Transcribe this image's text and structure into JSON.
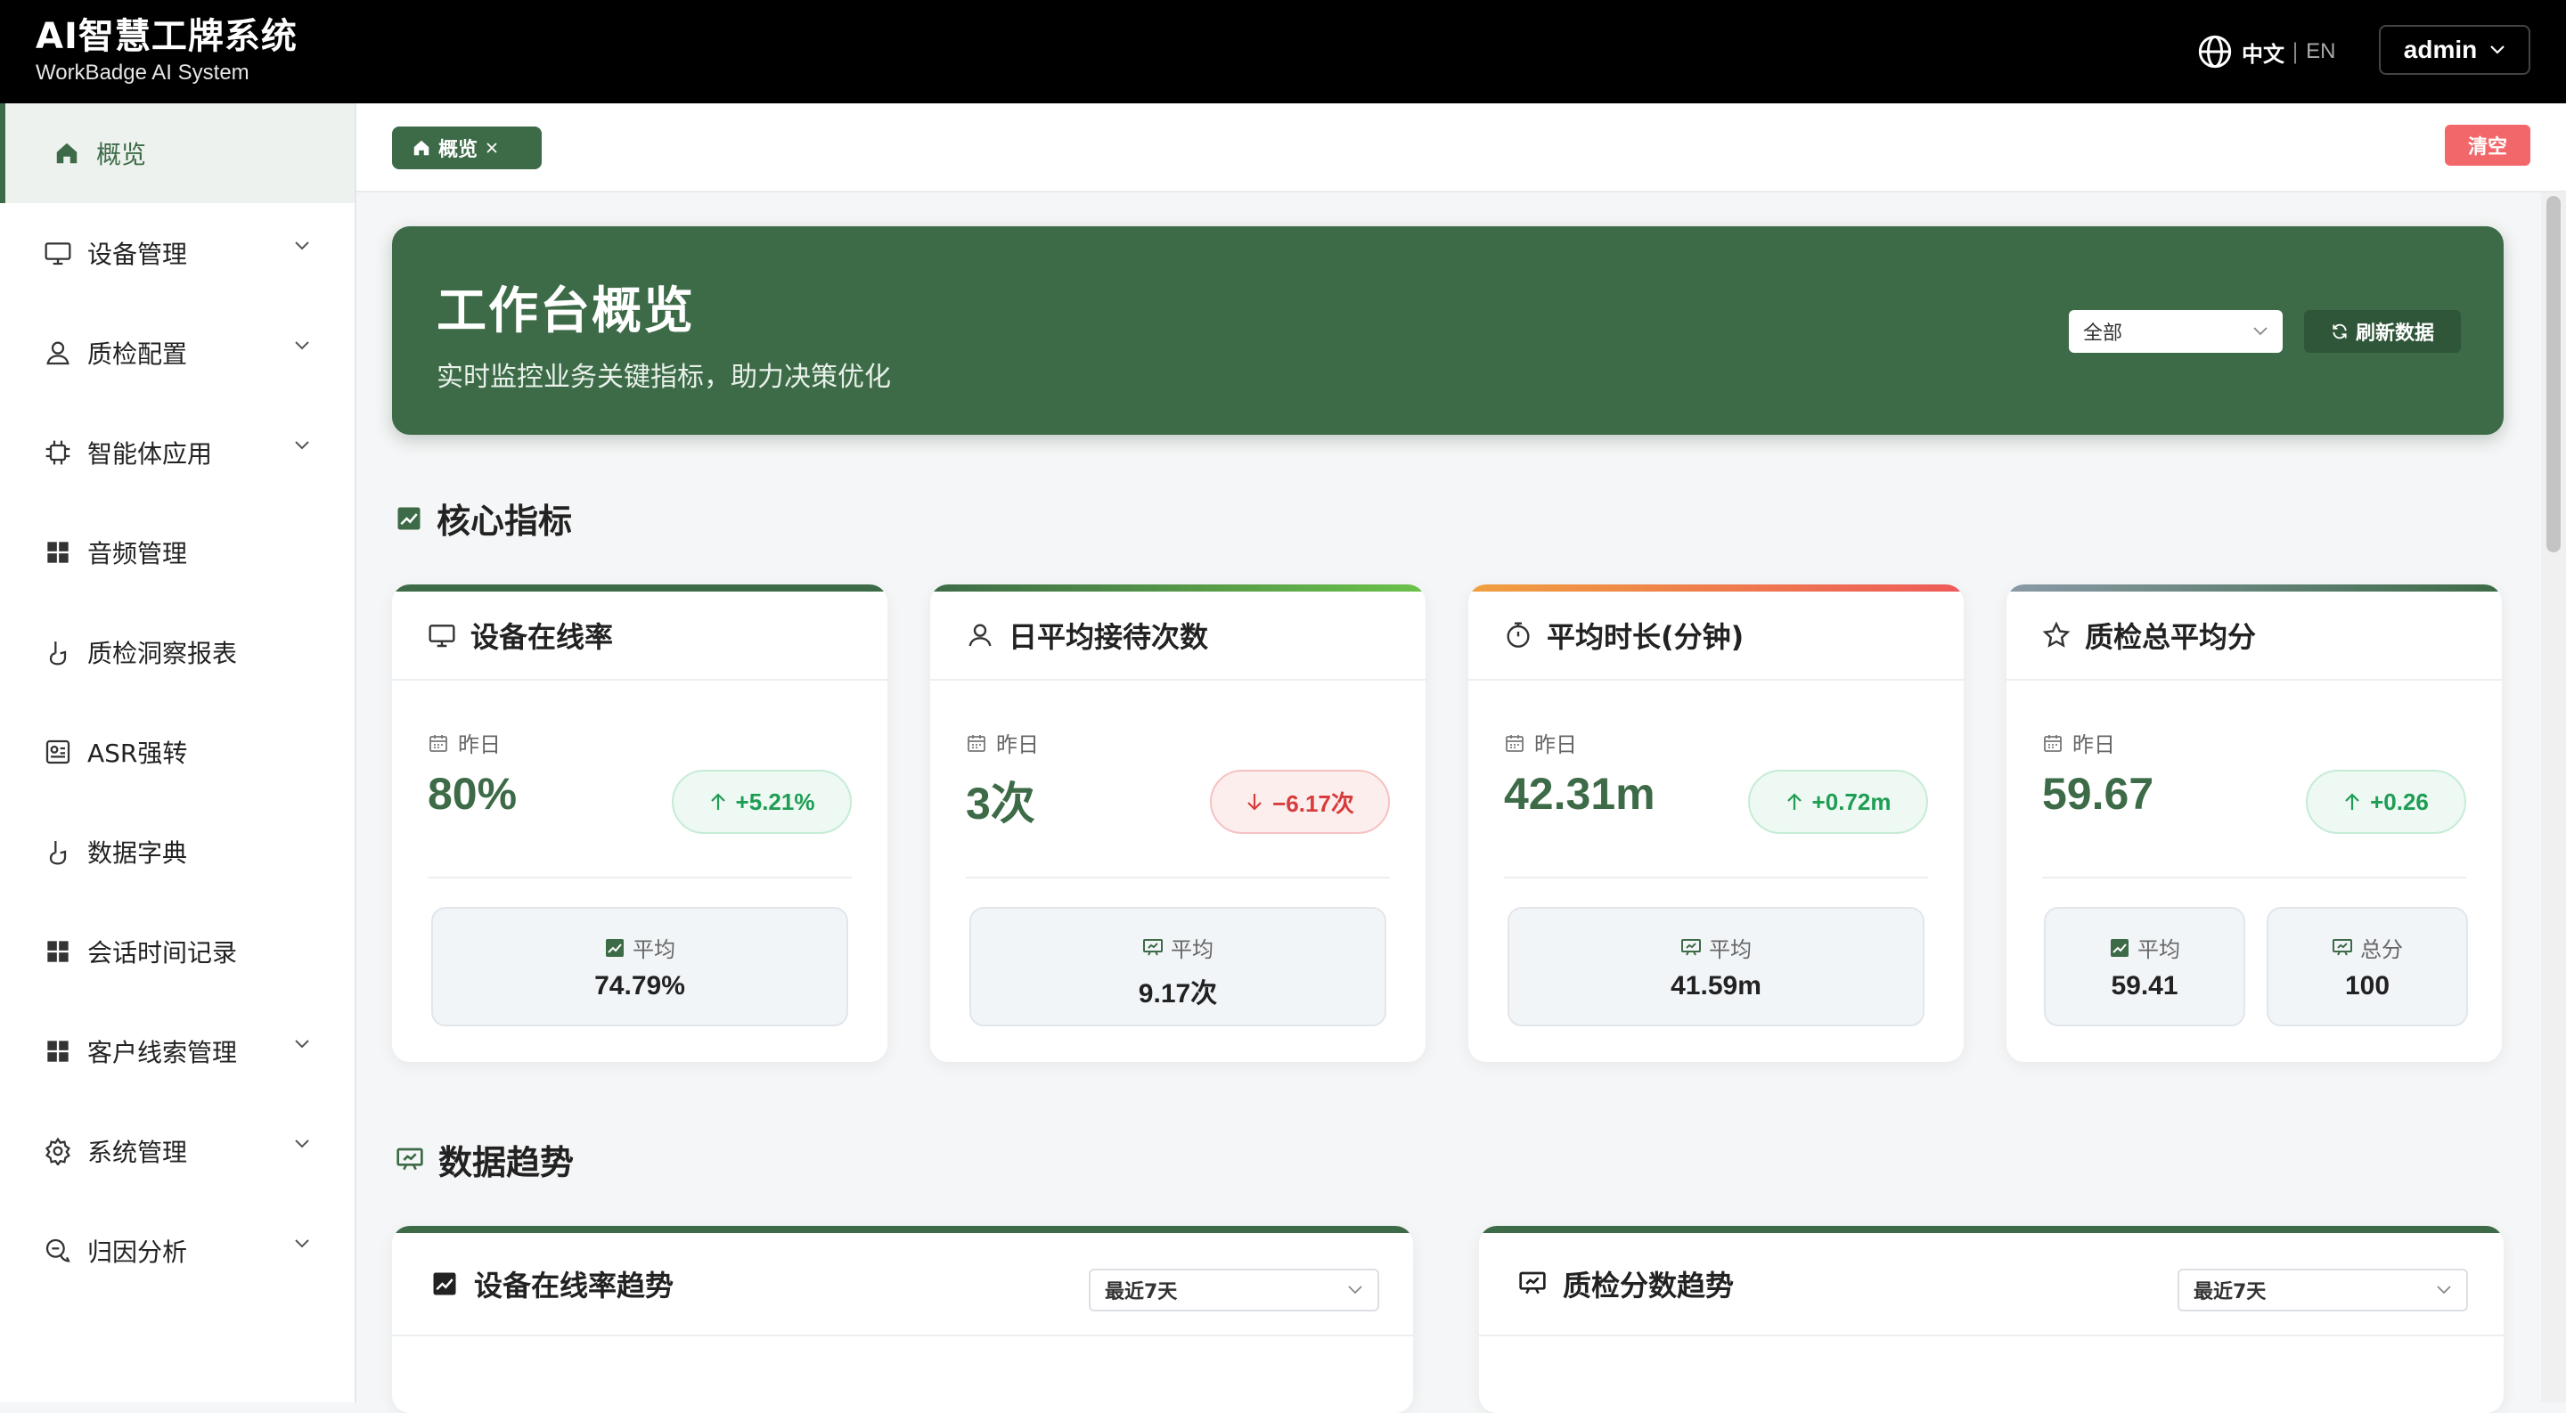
{
  "brand": {
    "title": "AI智慧工牌系统",
    "subtitle": "WorkBadge AI System"
  },
  "header": {
    "lang_active": "中文",
    "lang_sep": "|",
    "lang_other": "EN",
    "user": "admin"
  },
  "sidebar": {
    "items": [
      {
        "label": "概览",
        "icon": "home-icon",
        "active": true,
        "expandable": false
      },
      {
        "label": "设备管理",
        "icon": "monitor-icon",
        "expandable": true
      },
      {
        "label": "质检配置",
        "icon": "user-icon",
        "expandable": true
      },
      {
        "label": "智能体应用",
        "icon": "chip-icon",
        "expandable": true
      },
      {
        "label": "音频管理",
        "icon": "grid-icon",
        "expandable": false
      },
      {
        "label": "质检洞察报表",
        "icon": "hand-icon",
        "expandable": false
      },
      {
        "label": "ASR强转",
        "icon": "asr-icon",
        "expandable": false
      },
      {
        "label": "数据字典",
        "icon": "hand-icon",
        "expandable": false
      },
      {
        "label": "会话时间记录",
        "icon": "grid-icon",
        "expandable": false
      },
      {
        "label": "客户线索管理",
        "icon": "grid-icon",
        "expandable": true
      },
      {
        "label": "系统管理",
        "icon": "gear-icon",
        "expandable": true
      },
      {
        "label": "归因分析",
        "icon": "chat-icon",
        "expandable": true
      }
    ]
  },
  "tabs": {
    "current": "概览",
    "clear": "清空"
  },
  "banner": {
    "title": "工作台概览",
    "subtitle": "实时监控业务关键指标，助力决策优化",
    "scope": "全部",
    "refresh": "刷新数据"
  },
  "sections": {
    "core": "核心指标",
    "trend": "数据趋势"
  },
  "metrics": [
    {
      "title": "设备在线率",
      "icon": "monitor-icon",
      "period": "昨日",
      "value": "80%",
      "delta": "+5.21%",
      "direction": "up",
      "accent": [
        "#3d6b47",
        "#3d6b47"
      ],
      "stats": [
        {
          "label": "平均",
          "value": "74.79%",
          "icon": "trend-icon"
        }
      ]
    },
    {
      "title": "日平均接待次数",
      "icon": "user-icon",
      "period": "昨日",
      "value": "3次",
      "delta": "−6.17次",
      "direction": "down",
      "accent": [
        "#3d6b47",
        "#6cc24a"
      ],
      "stats": [
        {
          "label": "平均",
          "value": "9.17次",
          "icon": "board-icon"
        }
      ]
    },
    {
      "title": "平均时长(分钟)",
      "icon": "timer-icon",
      "period": "昨日",
      "value": "42.31m",
      "delta": "+0.72m",
      "direction": "up",
      "accent": [
        "#f0a040",
        "#ee5a5a"
      ],
      "stats": [
        {
          "label": "平均",
          "value": "41.59m",
          "icon": "board-icon"
        }
      ]
    },
    {
      "title": "质检总平均分",
      "icon": "star-icon",
      "period": "昨日",
      "value": "59.67",
      "delta": "+0.26",
      "direction": "up",
      "accent": [
        "#8a9aa6",
        "#3d6b47"
      ],
      "stats": [
        {
          "label": "平均",
          "value": "59.41",
          "icon": "trend-icon"
        },
        {
          "label": "总分",
          "value": "100",
          "icon": "board-icon"
        }
      ]
    }
  ],
  "trends": [
    {
      "title": "设备在线率趋势",
      "icon": "trend-icon",
      "range": "最近7天"
    },
    {
      "title": "质检分数趋势",
      "icon": "board-icon",
      "range": "最近7天"
    }
  ],
  "colors": {
    "primary": "#3d6b47",
    "danger": "#f2686a",
    "up": "#1f9d55",
    "down": "#d93a3a"
  }
}
